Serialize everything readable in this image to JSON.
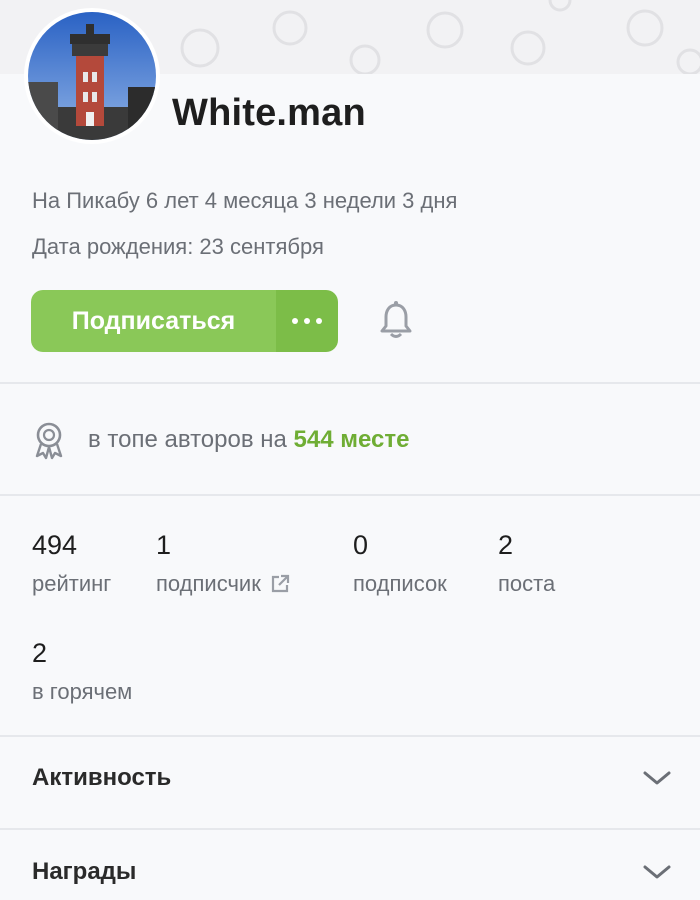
{
  "profile": {
    "username": "White.man",
    "on_site": "На Пикабу 6 лет 4 месяца 3 недели 3 дня",
    "birthday": "Дата рождения: 23 сентября"
  },
  "actions": {
    "subscribe_label": "Подписаться",
    "more_icon": "more-dots-icon",
    "bell_icon": "bell-icon"
  },
  "rank": {
    "icon": "award-ribbon-icon",
    "text": "в топе авторов на",
    "value": "544 месте"
  },
  "stats": [
    {
      "value": "494",
      "label": "рейтинг"
    },
    {
      "value": "1",
      "label": "подписчик"
    },
    {
      "value": "0",
      "label": "подписок"
    },
    {
      "value": "2",
      "label": "поста"
    },
    {
      "value": "2",
      "label": "в горячем"
    }
  ],
  "sections": [
    {
      "label": "Активность"
    },
    {
      "label": "Награды"
    }
  ],
  "colors": {
    "accent_green": "#8ac858",
    "rank_green": "#6fad34"
  }
}
